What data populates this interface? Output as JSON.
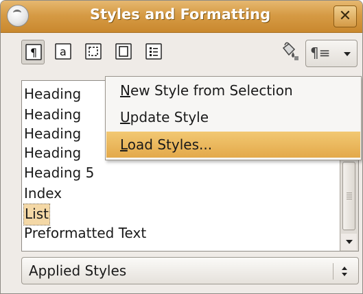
{
  "window": {
    "title": "Styles and Formatting",
    "accent": "#d99a44"
  },
  "toolbar": {
    "buttons": [
      {
        "name": "paragraph-styles",
        "glyph": "¶",
        "active": true
      },
      {
        "name": "character-styles",
        "glyph": "a",
        "active": false
      },
      {
        "name": "frame-styles",
        "glyph": "frame",
        "active": false
      },
      {
        "name": "page-styles",
        "glyph": "page",
        "active": false
      },
      {
        "name": "list-styles",
        "glyph": "list",
        "active": false
      }
    ],
    "fill_format_icon": "fill-format-icon",
    "new_style_glyph": "¶≡"
  },
  "styles_list": {
    "items": [
      {
        "label": "Heading",
        "selected": false
      },
      {
        "label": "Heading",
        "selected": false
      },
      {
        "label": "Heading",
        "selected": false
      },
      {
        "label": "Heading",
        "selected": false
      },
      {
        "label": "Heading 5",
        "selected": false
      },
      {
        "label": "Index",
        "selected": false
      },
      {
        "label": "List",
        "selected": true
      },
      {
        "label": "Preformatted Text",
        "selected": false
      }
    ]
  },
  "filter": {
    "selected": "Applied Styles"
  },
  "context_menu": {
    "items": [
      {
        "pre": "",
        "mnemonic": "N",
        "rest": "ew Style from Selection",
        "hover": false
      },
      {
        "pre": "",
        "mnemonic": "U",
        "rest": "pdate Style",
        "hover": false
      },
      {
        "pre": "",
        "mnemonic": "L",
        "rest": "oad Styles...",
        "hover": true
      }
    ]
  }
}
